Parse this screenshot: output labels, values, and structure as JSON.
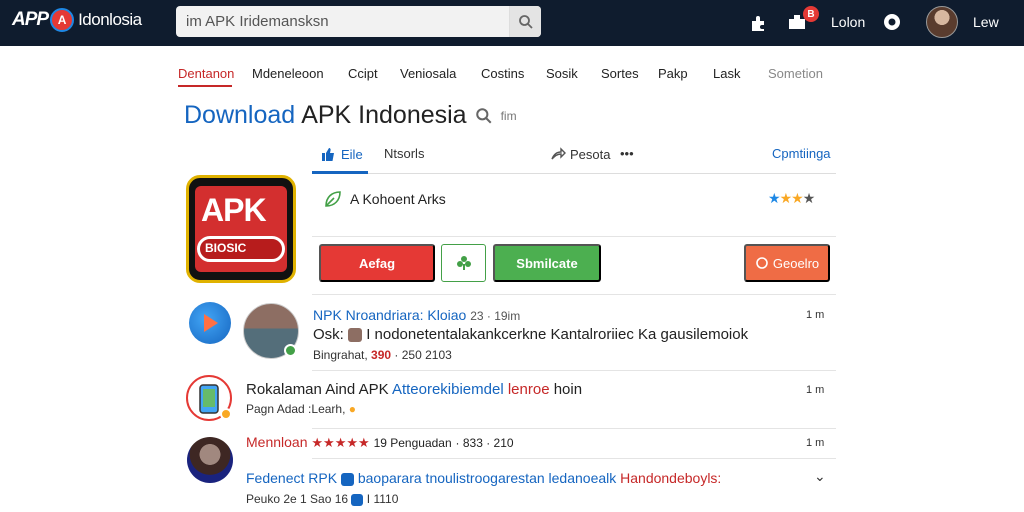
{
  "header": {
    "logo_app": "APP",
    "logo_badge": "A",
    "logo_brand": "Idonlosia",
    "search_value": "im APK Iridemansksn",
    "notif_count": "B",
    "login_label": "Lolon",
    "user_label": "Lew"
  },
  "nav": {
    "items": [
      "Dentanon",
      "Mdeneleoon",
      "Ccipt",
      "Veniosala",
      "Costins",
      "Sosik",
      "Sortes",
      "Pakp",
      "Lask",
      "Sometion"
    ]
  },
  "title": {
    "blue": "Download",
    "main": "APK Indonesia",
    "meta": "fim"
  },
  "subtabs": {
    "like": "Eile",
    "reports": "Ntsorls",
    "share": "Pesota",
    "more": "•••",
    "right": "Cpmtiinga"
  },
  "app": {
    "icon_text": "APK",
    "icon_sub": "BIOSIC",
    "developer": "A Kohoent Arks",
    "rating": 3,
    "rating_max": 4
  },
  "buttons": {
    "primary": "Aefag",
    "secondary": "Sbmilcate",
    "right": "Geoelro"
  },
  "list": [
    {
      "title": "NPK Nroandriara: Kloiao",
      "title_meta": "23 · 19im",
      "line2a": "Osk:",
      "line2b": "I nodonetentalakankcerkne Kantalroriiec Ka gausilemoiok",
      "sub_a": "Bingrahat,",
      "sub_num": "390",
      "sub_b": "· 250 2103",
      "time": "1 m"
    },
    {
      "title_a": "Rokalaman Aind APK",
      "title_b": "Atteorekibiemdel",
      "title_c": "lenroe",
      "title_d": "hoin",
      "sub": "Pagn Adad :Learh,",
      "time": "1 m"
    },
    {
      "title_a": "Mennloan",
      "stars": "★★★★★",
      "title_b": "19 Penguadan",
      "title_c": "· 833 · 210",
      "time": "1 m"
    },
    {
      "title_a": "Fedenect RPK",
      "title_b": "baoparara tnoulistroogarestan ledanoealk",
      "title_c": "Handondeboyls:",
      "sub_a": "Peuko 2e 1 Sao 16",
      "sub_b": "I 1110",
      "chevron": "⌄"
    }
  ],
  "colors": {
    "topbar": "#0f1c2e",
    "accent_blue": "#1565c0",
    "accent_red": "#e53935",
    "accent_green": "#4caf50",
    "accent_orange": "#ef6c45"
  }
}
